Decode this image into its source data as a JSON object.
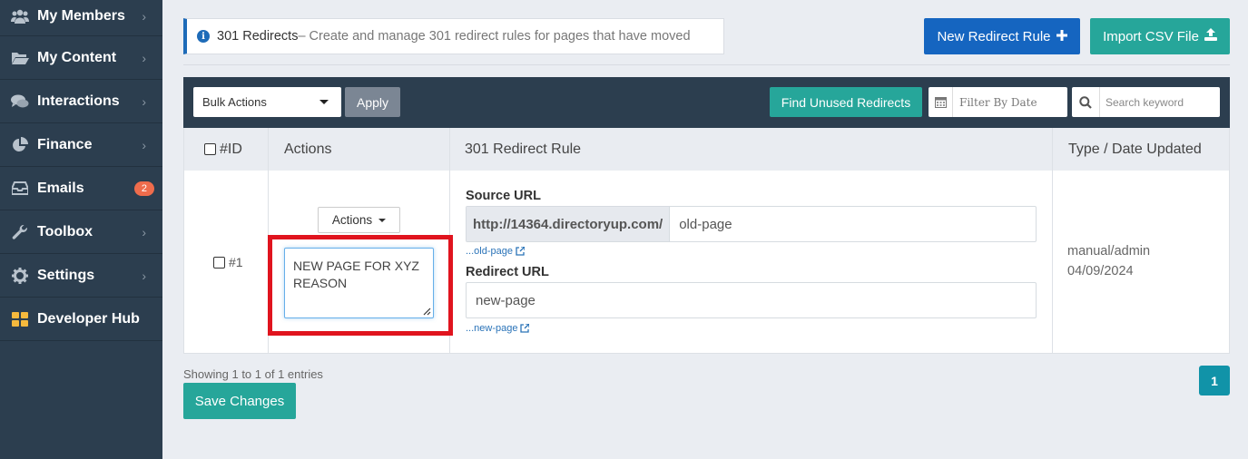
{
  "sidebar": {
    "items": [
      {
        "label": "My Members",
        "icon": "users-icon"
      },
      {
        "label": "My Content",
        "icon": "folder-open-icon"
      },
      {
        "label": "Interactions",
        "icon": "comments-icon"
      },
      {
        "label": "Finance",
        "icon": "pie-chart-icon"
      },
      {
        "label": "Emails",
        "icon": "inbox-icon",
        "badge": "2"
      },
      {
        "label": "Toolbox",
        "icon": "wrench-icon"
      },
      {
        "label": "Settings",
        "icon": "gear-icon"
      },
      {
        "label": "Developer Hub",
        "icon": "grid-icon"
      }
    ]
  },
  "info": {
    "title": "301 Redirects",
    "description": " – Create and manage 301 redirect rules for pages that have moved"
  },
  "header_buttons": {
    "new_rule": "New Redirect Rule",
    "import_csv": "Import CSV File"
  },
  "toolbar": {
    "bulk_select": "Bulk Actions",
    "apply": "Apply",
    "find_unused": "Find Unused Redirects",
    "filter_date_placeholder": "Filter By Date",
    "search_placeholder": "Search keyword"
  },
  "table": {
    "headers": {
      "id": "#ID",
      "actions": "Actions",
      "rule": "301 Redirect Rule",
      "type_date": "Type / Date Updated"
    },
    "row": {
      "id": "#1",
      "actions_label": "Actions",
      "note": "NEW PAGE FOR XYZ REASON",
      "source_label": "Source URL",
      "source_prefix": "http://14364.directoryup.com/",
      "source_value": "old-page",
      "source_link": "...old-page",
      "redirect_label": "Redirect URL",
      "redirect_value": "new-page",
      "redirect_link": "...new-page",
      "type": "manual/admin",
      "date": "04/09/2024"
    }
  },
  "footer": {
    "showing": "Showing 1 to 1 of 1 entries",
    "save": "Save Changes",
    "page": "1"
  },
  "colors": {
    "sidebar_bg": "#2c3e4f",
    "primary_blue": "#1565c0",
    "teal": "#26a69a",
    "highlight_red": "#e0141e",
    "badge": "#ef6c4c"
  }
}
